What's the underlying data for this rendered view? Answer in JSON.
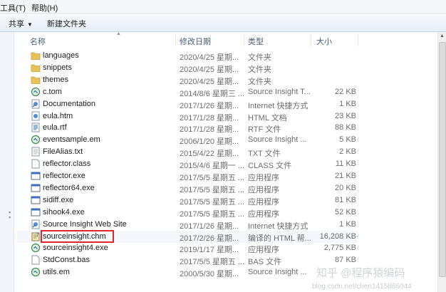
{
  "menu": {
    "tools": "工具(T)",
    "help": "帮助(H)"
  },
  "toolbar": {
    "share": "共享",
    "new_folder": "新建文件夹"
  },
  "columns": {
    "name": "名称",
    "date": "修改日期",
    "type": "类型",
    "size": "大小"
  },
  "files": [
    {
      "name": "languages",
      "date": "2020/4/25 星期...",
      "type": "文件夹",
      "size": "",
      "icon": "folder-icon"
    },
    {
      "name": "snippets",
      "date": "2020/4/25 星期...",
      "type": "文件夹",
      "size": "",
      "icon": "folder-icon"
    },
    {
      "name": "themes",
      "date": "2020/4/25 星期...",
      "type": "文件夹",
      "size": "",
      "icon": "folder-icon"
    },
    {
      "name": "c.tom",
      "date": "2014/8/6 星期三 ...",
      "type": "Source Insight T...",
      "size": "22 KB",
      "icon": "source-insight-icon"
    },
    {
      "name": "Documentation",
      "date": "2017/1/26 星期...",
      "type": "Internet 快捷方式",
      "size": "1 KB",
      "icon": "internet-shortcut-icon"
    },
    {
      "name": "eula.htm",
      "date": "2017/1/28 星期...",
      "type": "HTML 文档",
      "size": "23 KB",
      "icon": "html-doc-icon"
    },
    {
      "name": "eula.rtf",
      "date": "2017/1/28 星期...",
      "type": "RTF 文件",
      "size": "88 KB",
      "icon": "rtf-doc-icon"
    },
    {
      "name": "eventsample.em",
      "date": "2006/1/20 星期...",
      "type": "Source Insight ...",
      "size": "5 KB",
      "icon": "source-insight-icon"
    },
    {
      "name": "FileAlias.txt",
      "date": "2015/4/22 星期...",
      "type": "TXT 文件",
      "size": "2 KB",
      "icon": "text-file-icon"
    },
    {
      "name": "reflector.class",
      "date": "2015/4/6 星期一 ...",
      "type": "CLASS 文件",
      "size": "11 KB",
      "icon": "blank-file-icon"
    },
    {
      "name": "reflector.exe",
      "date": "2017/5/5 星期五 ...",
      "type": "应用程序",
      "size": "21 KB",
      "icon": "exe-icon"
    },
    {
      "name": "reflector64.exe",
      "date": "2017/5/5 星期五 ...",
      "type": "应用程序",
      "size": "20 KB",
      "icon": "exe-icon"
    },
    {
      "name": "sidiff.exe",
      "date": "2017/5/5 星期五 ...",
      "type": "应用程序",
      "size": "81 KB",
      "icon": "exe-icon"
    },
    {
      "name": "sihook4.exe",
      "date": "2017/5/5 星期五 ...",
      "type": "应用程序",
      "size": "52 KB",
      "icon": "exe-icon"
    },
    {
      "name": "Source Insight Web Site",
      "date": "2017/1/26 星期...",
      "type": "Internet 快捷方式",
      "size": "1 KB",
      "icon": "internet-shortcut-icon"
    },
    {
      "name": "sourceinsight.chm",
      "date": "2017/2/26 星期...",
      "type": "编译的 HTML 帮...",
      "size": "16,208 KB",
      "icon": "chm-help-icon",
      "selected": true
    },
    {
      "name": "sourceinsight4.exe",
      "date": "2019/1/17 星期...",
      "type": "应用程序",
      "size": "2,775 KB",
      "icon": "source-insight-icon"
    },
    {
      "name": "StdConst.bas",
      "date": "2017/5/5 星期五 ...",
      "type": "BAS 文件",
      "size": "87 KB",
      "icon": "blank-file-icon"
    },
    {
      "name": "utils.em",
      "date": "2000/5/30 星期...",
      "type": "Source Insight ...",
      "size": "",
      "icon": "source-insight-icon"
    }
  ],
  "watermark": {
    "text": "知乎 @程序猿编码",
    "url": "blog.csdn.net/chen1415886044"
  },
  "colors": {
    "highlight_box": "#e0242b",
    "folder": "#e8c35a",
    "header_text": "#4c607a"
  }
}
